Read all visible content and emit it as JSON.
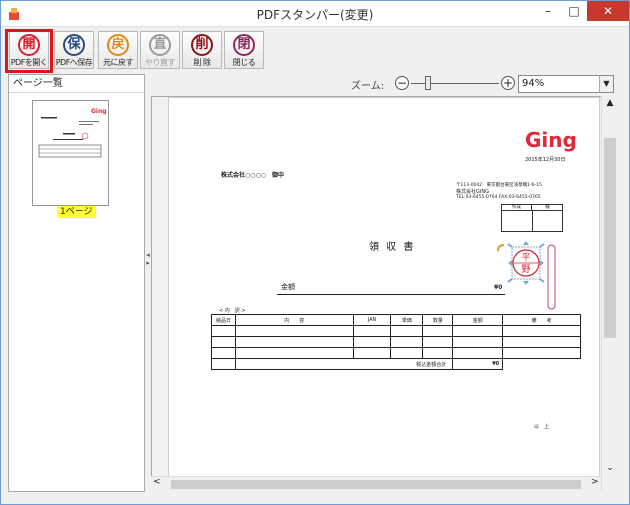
{
  "window": {
    "title": "PDFスタンパー(変更)",
    "controls": {
      "minimize": "–",
      "maximize": "□",
      "close": "✕"
    }
  },
  "toolbar": {
    "buttons": [
      {
        "stamp": "開",
        "label": "PDFを開く",
        "color": "#d9212c",
        "enabled": true
      },
      {
        "stamp": "保",
        "label": "PDFへ保存",
        "color": "#2a4b7c",
        "enabled": true
      },
      {
        "stamp": "戻",
        "label": "元に戻す",
        "color": "#e08a14",
        "enabled": true
      },
      {
        "stamp": "直",
        "label": "やり直す",
        "color": "#9a9a9a",
        "enabled": false
      },
      {
        "stamp": "削",
        "label": "削 除",
        "color": "#8a1414",
        "enabled": true
      },
      {
        "stamp": "閉",
        "label": "閉じる",
        "color": "#8a2a5c",
        "enabled": true
      }
    ]
  },
  "left_panel": {
    "header": "ページ一覧",
    "pages": [
      {
        "label": "1ページ"
      }
    ]
  },
  "zoom": {
    "label": "ズーム:",
    "minus": "−",
    "plus": "+",
    "value": "94%",
    "level_percent": 94
  },
  "document": {
    "logo": "Ging",
    "date": "2015年12月30日",
    "addressee": "株式会社○○○○　御中",
    "sender_lines": [
      "〒113-0042　東京都台東区浅草橋1-6-15",
      "株式会社GING",
      "TEL:03-6455-0764  FAX:03-6455-0765"
    ],
    "approval_headers": [
      "作成",
      "検"
    ],
    "doc_title": "領 収 書",
    "amount_label": "金額",
    "amount_value": "¥0",
    "breakdown_label": "< 内　訳 >",
    "table_headers": [
      "納品日",
      "内　　容",
      "JAN",
      "単価",
      "数量",
      "金額",
      "備　　考"
    ],
    "subtotal_label": "税込金額合計",
    "subtotal_value": "¥0",
    "closing": "以　上",
    "stamp_seal": {
      "top": "平",
      "bottom": "野"
    }
  },
  "scroll": {
    "up": "▲",
    "down": "⌄",
    "left": "<",
    "right": ">"
  },
  "splitter": "◂ ▸"
}
